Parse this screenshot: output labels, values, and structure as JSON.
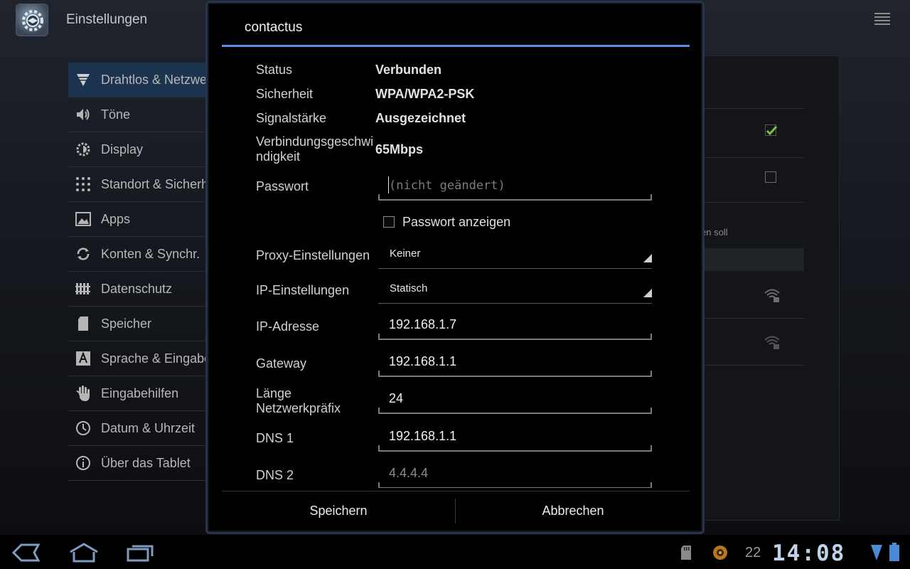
{
  "actionbar": {
    "title": "Einstellungen"
  },
  "nav": {
    "items": [
      {
        "label": "Drahtlos & Netzwerke",
        "icon": "wifi-icon",
        "selected": true
      },
      {
        "label": "Töne",
        "icon": "speaker-icon"
      },
      {
        "label": "Display",
        "icon": "brightness-icon"
      },
      {
        "label": "Standort & Sicherheit",
        "icon": "location-grid-icon"
      },
      {
        "label": "Apps",
        "icon": "apps-icon"
      },
      {
        "label": "Konten & Synchr.",
        "icon": "sync-icon"
      },
      {
        "label": "Datenschutz",
        "icon": "privacy-icon"
      },
      {
        "label": "Speicher",
        "icon": "storage-icon"
      },
      {
        "label": "Sprache & Eingabe",
        "icon": "language-icon"
      },
      {
        "label": "Eingabehilfen",
        "icon": "hand-icon"
      },
      {
        "label": "Datum & Uhrzeit",
        "icon": "clock-icon"
      },
      {
        "label": "Über das Tablet",
        "icon": "info-icon"
      }
    ]
  },
  "right_panel": {
    "partial_text": "en soll"
  },
  "dialog": {
    "title": "contactus",
    "status": {
      "label": "Status",
      "value": "Verbunden"
    },
    "security": {
      "label": "Sicherheit",
      "value": "WPA/WPA2-PSK"
    },
    "signal": {
      "label": "Signalstärke",
      "value": "Ausgezeichnet"
    },
    "speed": {
      "label": "Verbindungsgeschwindigkeit",
      "value": "65Mbps"
    },
    "password": {
      "label": "Passwort",
      "placeholder": "(nicht geändert)"
    },
    "show_password": {
      "label": "Passwort anzeigen",
      "checked": false
    },
    "proxy": {
      "label": "Proxy-Einstellungen",
      "value": "Keiner"
    },
    "ip_settings": {
      "label": "IP-Einstellungen",
      "value": "Statisch"
    },
    "ip_address": {
      "label": "IP-Adresse",
      "value": "192.168.1.7"
    },
    "gateway": {
      "label": "Gateway",
      "value": "192.168.1.1"
    },
    "prefix": {
      "label": "Länge Netzwerkpräfix",
      "value": "24"
    },
    "dns1": {
      "label": "DNS 1",
      "value": "192.168.1.1"
    },
    "dns2": {
      "label": "DNS 2",
      "value": "4.4.4.4"
    },
    "buttons": {
      "save": "Speichern",
      "cancel": "Abbrechen"
    }
  },
  "systembar": {
    "notification_count": "22",
    "time": "14:08"
  },
  "colors": {
    "accent": "#5f8ce8",
    "selected_nav": "#1d3450",
    "check_green": "#7bc242"
  }
}
